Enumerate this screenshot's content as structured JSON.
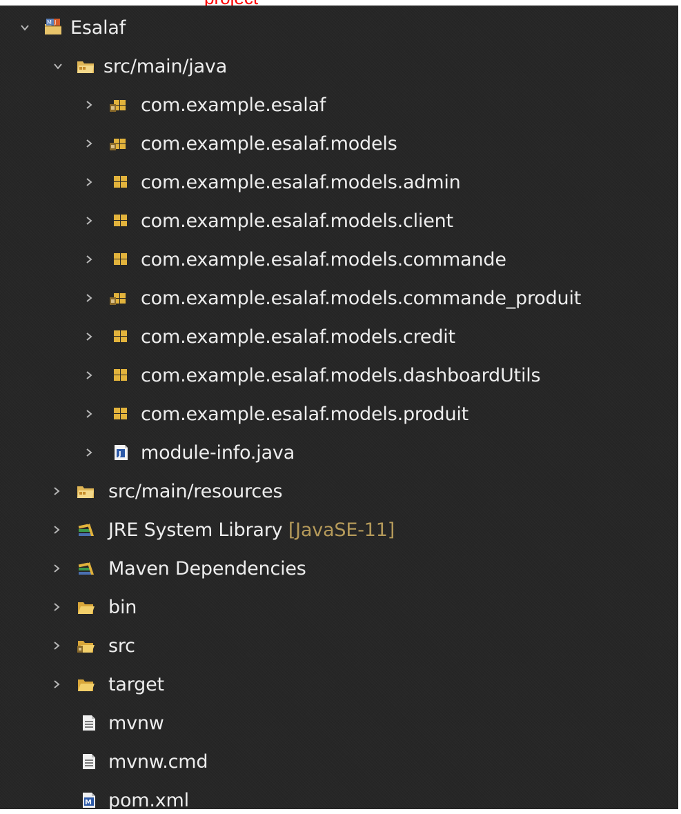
{
  "header": {
    "cut_text": "project"
  },
  "colors": {
    "panel_bg": "#262626",
    "text": "#ededed",
    "decoration": "#b59a5a",
    "chevron": "#b8b8b8"
  },
  "tree": {
    "project": {
      "label": "Esalaf",
      "expanded": true,
      "icon": "maven-project-icon"
    },
    "src_main_java": {
      "label": "src/main/java",
      "expanded": true,
      "icon": "source-folder-icon"
    },
    "packages": [
      {
        "label": "com.example.esalaf",
        "icon": "package-problem-icon"
      },
      {
        "label": "com.example.esalaf.models",
        "icon": "package-problem-icon"
      },
      {
        "label": "com.example.esalaf.models.admin",
        "icon": "package-icon"
      },
      {
        "label": "com.example.esalaf.models.client",
        "icon": "package-icon"
      },
      {
        "label": "com.example.esalaf.models.commande",
        "icon": "package-icon"
      },
      {
        "label": "com.example.esalaf.models.commande_produit",
        "icon": "package-problem-icon"
      },
      {
        "label": "com.example.esalaf.models.credit",
        "icon": "package-icon"
      },
      {
        "label": "com.example.esalaf.models.dashboardUtils",
        "icon": "package-icon"
      },
      {
        "label": "com.example.esalaf.models.produit",
        "icon": "package-icon"
      },
      {
        "label": "module-info.java",
        "icon": "java-file-icon"
      }
    ],
    "src_main_resources": {
      "label": "src/main/resources",
      "icon": "source-folder-icon"
    },
    "jre_library": {
      "label": "JRE System Library",
      "decoration": "[JavaSE-11]",
      "icon": "library-icon"
    },
    "maven_deps": {
      "label": "Maven Dependencies",
      "icon": "library-icon"
    },
    "bin": {
      "label": "bin",
      "icon": "folder-icon"
    },
    "src": {
      "label": "src",
      "icon": "folder-problem-icon"
    },
    "target": {
      "label": "target",
      "icon": "folder-icon"
    },
    "files": [
      {
        "label": "mvnw",
        "icon": "text-file-icon"
      },
      {
        "label": "mvnw.cmd",
        "icon": "text-file-icon"
      },
      {
        "label": "pom.xml",
        "icon": "maven-pom-icon"
      }
    ]
  }
}
